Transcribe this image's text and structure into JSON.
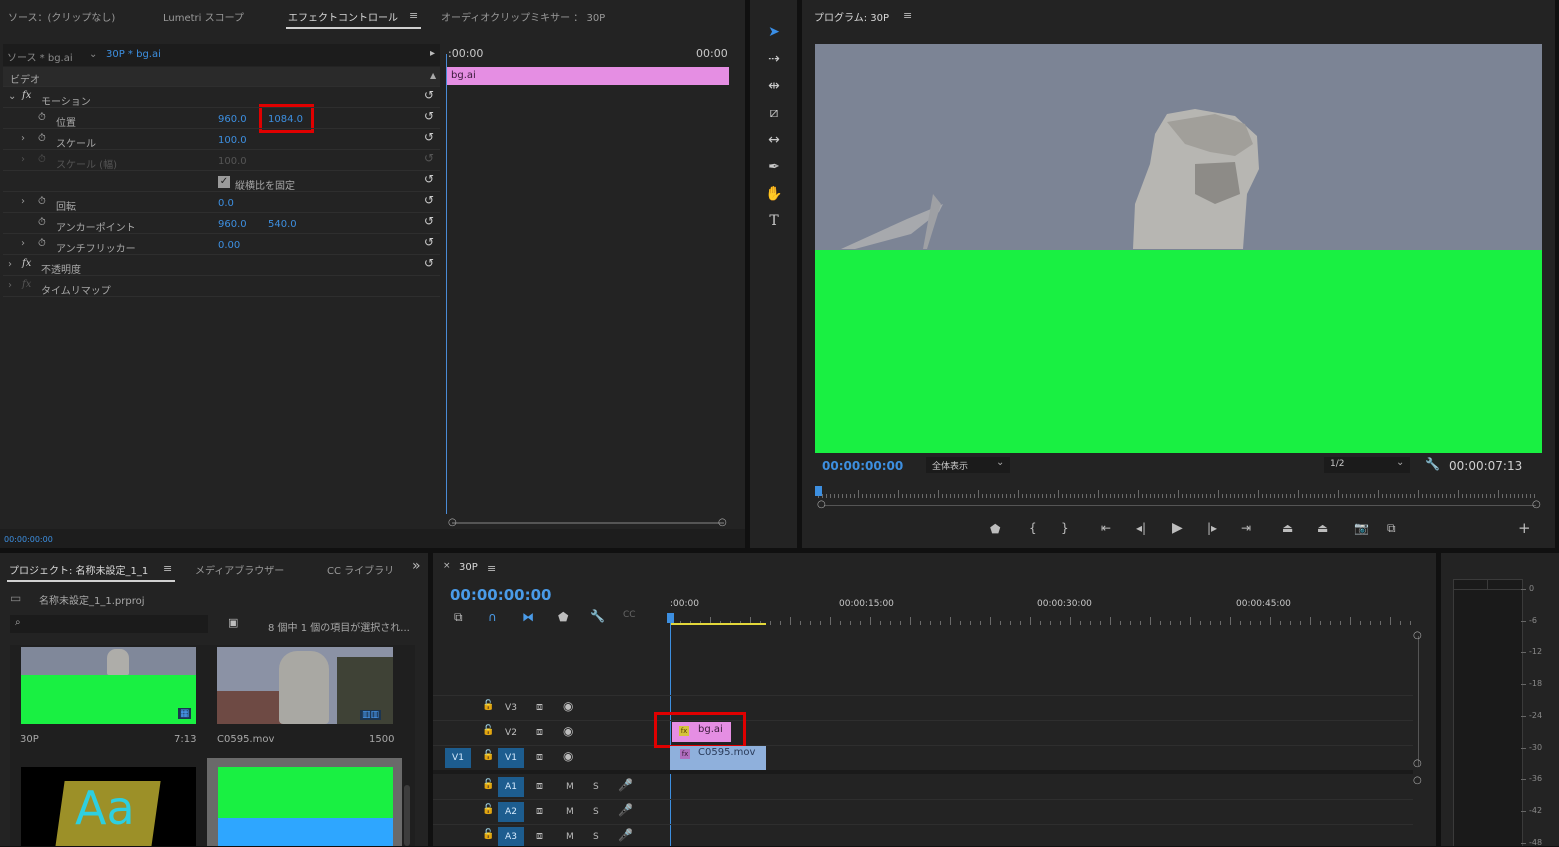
{
  "source_panel": {
    "tabs": [
      "ソース：(クリップなし)",
      "Lumetri スコープ",
      "エフェクトコントロール",
      "オーディオクリップミキサー ： 30P"
    ],
    "source_label": "ソース * bg.ai",
    "sequence_label": "30P * bg.ai",
    "time_start": ":00:00",
    "time_end": "00:00",
    "clip_name": "bg.ai",
    "section_video": "ビデオ",
    "motion": "モーション",
    "position_label": "位置",
    "position_x": "960.0",
    "position_y": "1084.0",
    "scale_label": "スケール",
    "scale_value": "100.0",
    "scale_width_label": "スケール (幅)",
    "scale_width_value": "100.0",
    "uniform_scale_label": "縦横比を固定",
    "rotation_label": "回転",
    "rotation_value": "0.0",
    "anchor_label": "アンカーポイント",
    "anchor_x": "960.0",
    "anchor_y": "540.0",
    "antiflicker_label": "アンチフリッカー",
    "antiflicker_value": "0.00",
    "opacity_label": "不透明度",
    "timeremap_label": "タイムリマップ",
    "timecode": "00:00:00:00"
  },
  "program_monitor": {
    "title": "プログラム: 30P",
    "timecode": "00:00:00:00",
    "fit": "全体表示",
    "resolution": "1/2",
    "duration": "00:00:07:13",
    "frame_colors": {
      "sky": "#7c8495",
      "green": "#19f042"
    }
  },
  "project_panel": {
    "tabs": [
      "プロジェクト: 名称未設定_1_1",
      "メディアブラウザー",
      "CC ライブラリ"
    ],
    "file": "名称未設定_1_1.prproj",
    "count": "8 個中 1 個の項目が選択され...",
    "items": [
      {
        "name": "30P",
        "duration": "7:13"
      },
      {
        "name": "C0595.mov",
        "duration": "1500"
      }
    ]
  },
  "timeline": {
    "sequence": "30P",
    "timecode": "00:00:00:00",
    "ruler": [
      ":00:00",
      "00:00:15:00",
      "00:00:30:00",
      "00:00:45:00"
    ],
    "video_tracks": [
      "V3",
      "V2",
      "V1"
    ],
    "audio_tracks": [
      "A1",
      "A2",
      "A3"
    ],
    "source_patch": "V1",
    "clip_v2": "bg.ai",
    "clip_v1": "C0595.mov",
    "mute": "M",
    "solo": "S"
  },
  "meter": {
    "labels": [
      "0",
      "-6",
      "-12",
      "-18",
      "-24",
      "-30",
      "-36",
      "-42",
      "-48"
    ]
  }
}
